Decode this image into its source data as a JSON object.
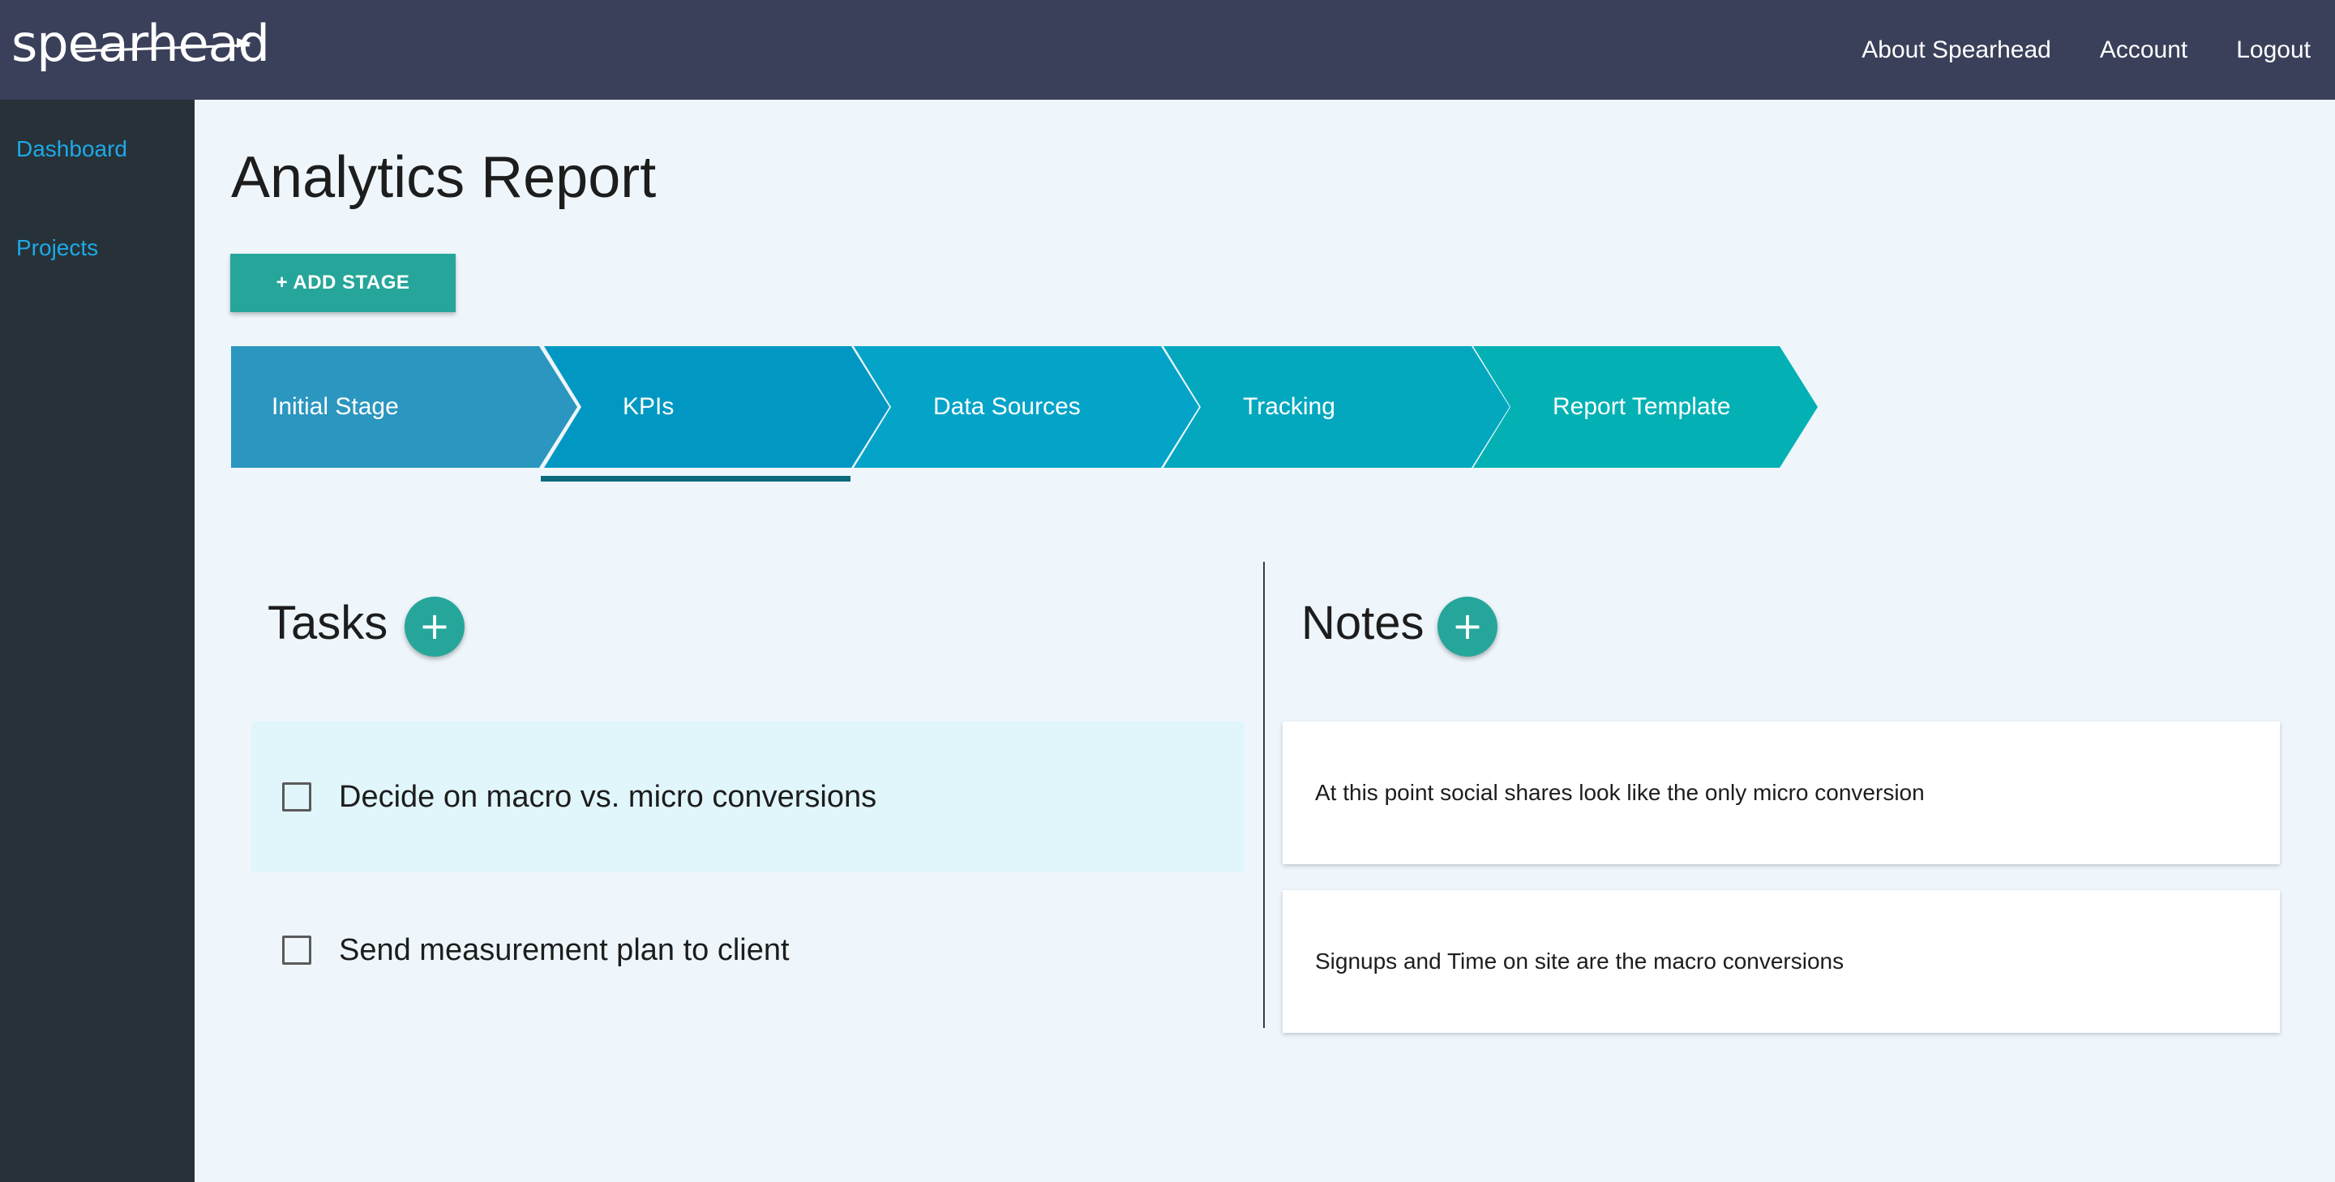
{
  "header": {
    "logo_text": "spearhead",
    "nav": [
      "About Spearhead",
      "Account",
      "Logout"
    ]
  },
  "sidebar": {
    "items": [
      {
        "label": "Dashboard"
      },
      {
        "label": "Projects"
      }
    ]
  },
  "main": {
    "title": "Analytics Report",
    "add_stage_label": "+ ADD STAGE",
    "stages": [
      {
        "label": "Initial Stage",
        "color": "#2b96bf"
      },
      {
        "label": "KPIs",
        "color": "#0098c2",
        "active": true
      },
      {
        "label": "Data Sources",
        "color": "#04a4c8"
      },
      {
        "label": "Tracking",
        "color": "#03a8bf"
      },
      {
        "label": "Report Template",
        "color": "#03b1b4"
      }
    ],
    "tasks": {
      "title": "Tasks",
      "add_icon": "+",
      "items": [
        {
          "text": "Decide on macro vs. micro conversions",
          "checked": false,
          "highlighted": true
        },
        {
          "text": "Send measurement plan to client",
          "checked": false,
          "highlighted": false
        }
      ]
    },
    "notes": {
      "title": "Notes",
      "add_icon": "+",
      "items": [
        {
          "text": "At this point social shares look like the only micro conversion"
        },
        {
          "text": "Signups and Time on site are the macro conversions"
        }
      ]
    }
  },
  "colors": {
    "topbar": "#3a405a",
    "sidebar": "#263238",
    "accent": "#26a69a",
    "link": "#1fa8e6"
  }
}
